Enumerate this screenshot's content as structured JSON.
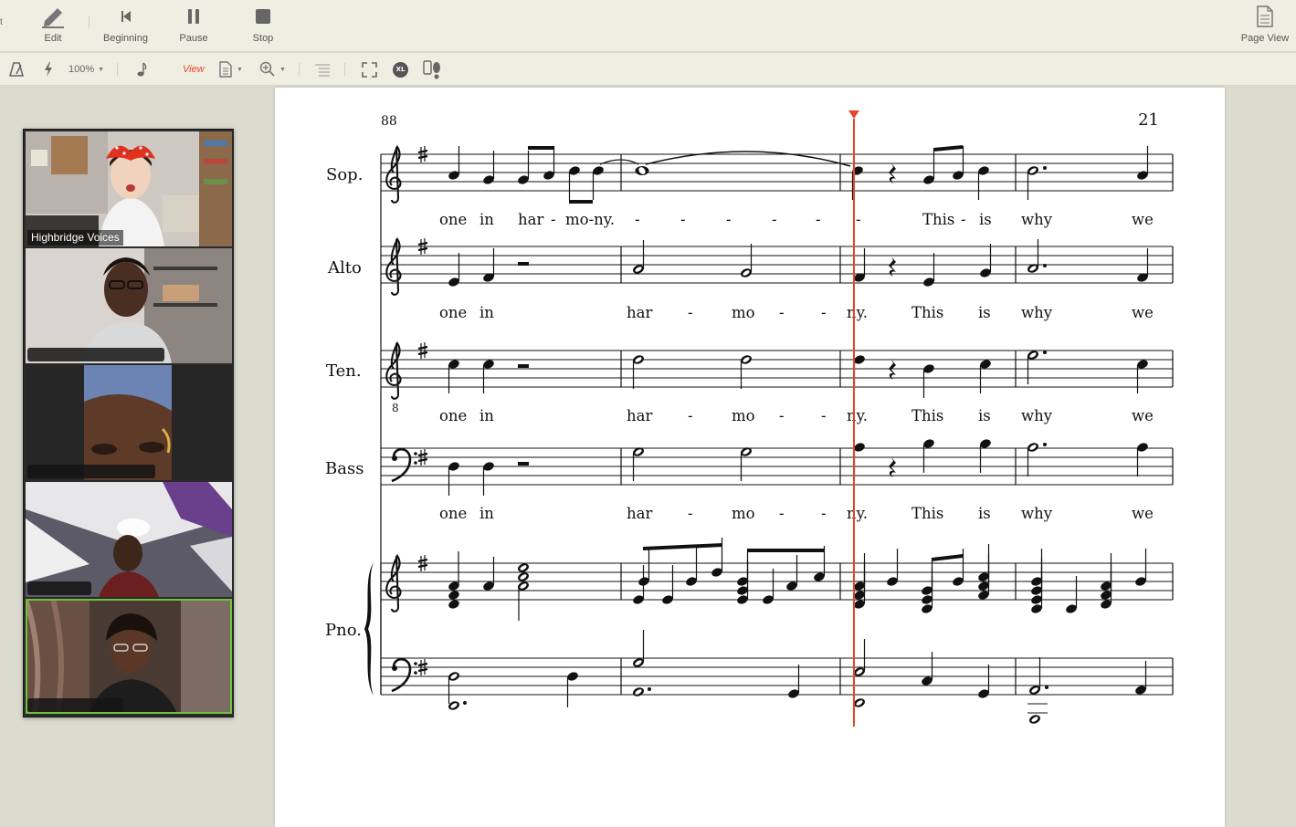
{
  "toolbar": {
    "edge_mark": "t",
    "edit_label": "Edit",
    "beginning_label": "Beginning",
    "pause_label": "Pause",
    "stop_label": "Stop",
    "page_view_label": "Page View"
  },
  "subtoolbar": {
    "zoom_value": "100%",
    "view_label": "View",
    "xl_label": "XL"
  },
  "video": {
    "tile1_name": "Highbridge Voices"
  },
  "score": {
    "measure_number": "88",
    "page_number": "21",
    "staves": [
      {
        "id": "sop",
        "label": "Sop.",
        "lyrics": [
          "one",
          "in",
          "har",
          "-",
          "mo-ny.",
          "-",
          "-",
          "-",
          "-",
          "-",
          "-",
          "This",
          "-",
          "is",
          "why",
          "we"
        ]
      },
      {
        "id": "alto",
        "label": "Alto",
        "lyrics": [
          "one",
          "in",
          "har",
          "-",
          "mo",
          "-",
          "-",
          "ny.",
          "This",
          "is",
          "why",
          "we"
        ]
      },
      {
        "id": "ten",
        "label": "Ten.",
        "lyrics": [
          "one",
          "in",
          "har",
          "-",
          "mo",
          "-",
          "-",
          "ny.",
          "This",
          "is",
          "why",
          "we"
        ]
      },
      {
        "id": "bass",
        "label": "Bass",
        "lyrics": [
          "one",
          "in",
          "har",
          "-",
          "mo",
          "-",
          "-",
          "ny.",
          "This",
          "is",
          "why",
          "we"
        ]
      }
    ],
    "piano_label": "Pno."
  },
  "colors": {
    "accent": "#e2462a",
    "active_speaker": "#6fc33b",
    "toolbar_bg": "#efeee2",
    "canvas_bg": "#dcdbcf"
  }
}
